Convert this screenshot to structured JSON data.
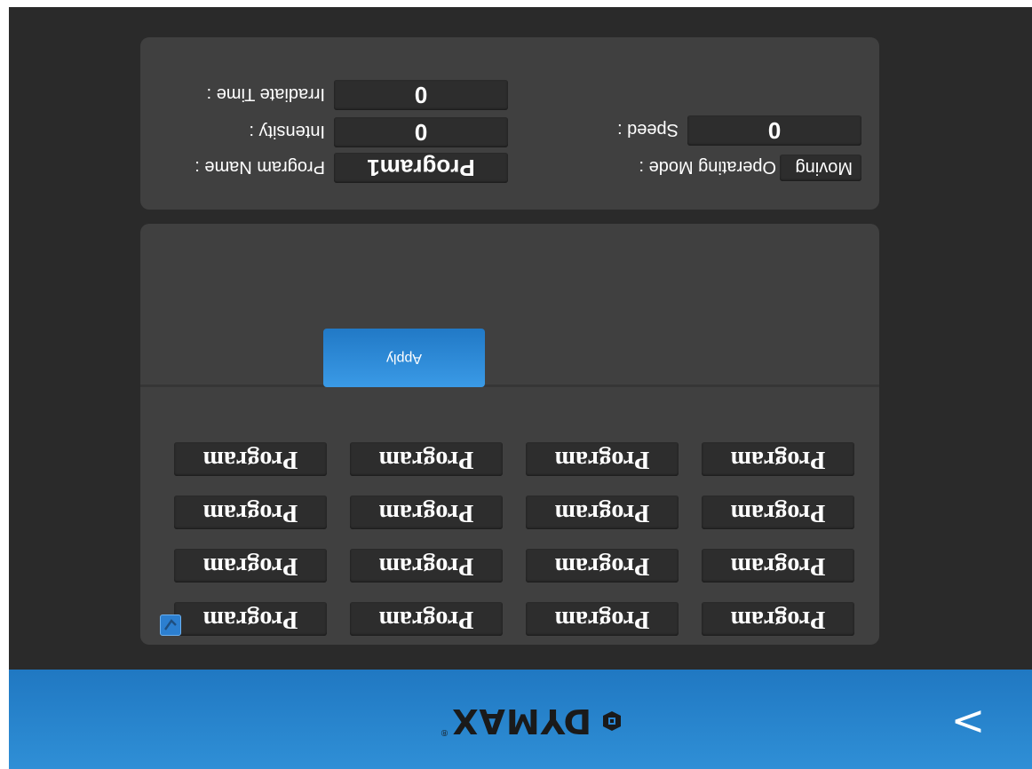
{
  "brand": {
    "logo_text": "DYMAX",
    "logo_reg": "®",
    "nav_icon": "chevron-right-icon",
    "nav_glyph": ">"
  },
  "colors": {
    "accent": "#2a86d2",
    "panel": "#404040",
    "field": "#2d2d2d",
    "background": "#2a2a2a"
  },
  "programs": {
    "rows": [
      [
        "Program",
        "Program",
        "Program",
        "Program"
      ],
      [
        "Program",
        "Program",
        "Program",
        "Program"
      ],
      [
        "Program",
        "Program",
        "Program",
        "Program"
      ],
      [
        "Program",
        "Program",
        "Program",
        "Program"
      ]
    ],
    "selected_checkbox": "checkbox-checked-icon"
  },
  "actions": {
    "apply_label": "Apply"
  },
  "info": {
    "program_name_label": "Program Name :",
    "program_name_value": "Program1",
    "intensity_label": "Intensity :",
    "intensity_value": "0",
    "irradiate_time_label": "Irradiate Time :",
    "irradiate_time_value": "0",
    "operating_mode_label": "Operating Mode :",
    "operating_mode_value": "Moving",
    "speed_label": "Speed :",
    "speed_value": "0"
  }
}
